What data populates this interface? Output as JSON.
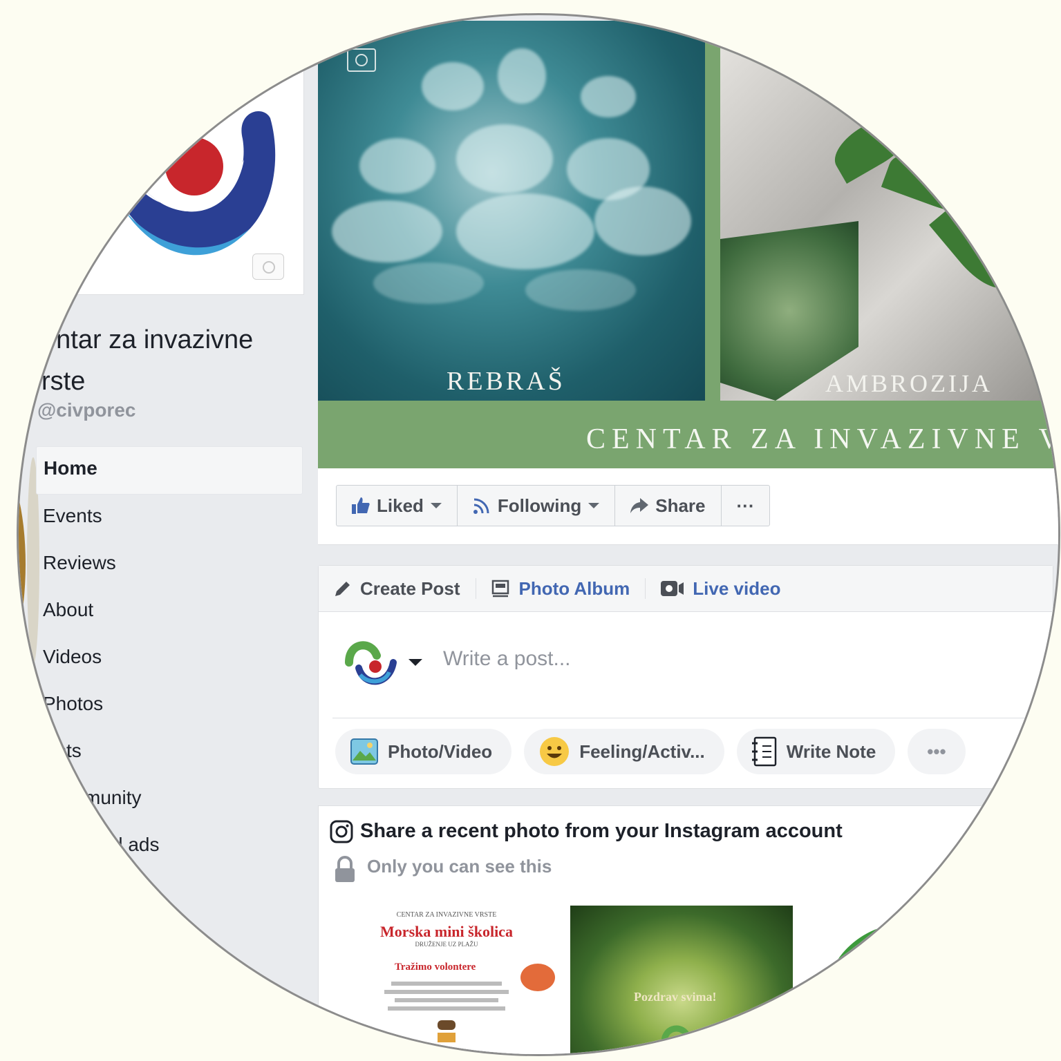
{
  "page": {
    "name": "entar za invazivne\nrste",
    "handle": "@civporec"
  },
  "nav": [
    {
      "label": "Home",
      "active": true
    },
    {
      "label": "Events"
    },
    {
      "label": "Reviews"
    },
    {
      "label": "About"
    },
    {
      "label": "Videos"
    },
    {
      "label": "Photos"
    },
    {
      "label": "sts"
    },
    {
      "label": "munity"
    },
    {
      "label": "d ads"
    }
  ],
  "cover": {
    "left_label": "REBRAŠ",
    "right_label": "AMBROZIJA",
    "banner": "CENTAR ZA INVAZIVNE V"
  },
  "actions": {
    "liked": "Liked",
    "following": "Following",
    "share": "Share",
    "more": "···"
  },
  "composer": {
    "tabs": {
      "create_post": "Create Post",
      "photo_album": "Photo Album",
      "live_video": "Live video"
    },
    "placeholder": "Write a post...",
    "pills": {
      "photo_video": "Photo/Video",
      "feeling": "Feeling/Activ...",
      "write_note": "Write Note",
      "more": "•••"
    }
  },
  "instagram": {
    "title": "Share a recent photo from your Instagram account",
    "privacy": "Only you can see this",
    "thumb1": {
      "header": "CENTAR ZA INVAZIVNE VRSTE",
      "title": "Morska mini školica",
      "subtitle": "DRUŽENJE UZ PLAŽU",
      "highlight": "Tražimo volontere"
    },
    "thumb2": {
      "text": "Pozdrav svima!"
    }
  },
  "colors": {
    "fb_blue": "#4267b2",
    "cover_green": "#7aa56f",
    "text_gray": "#90949c"
  }
}
